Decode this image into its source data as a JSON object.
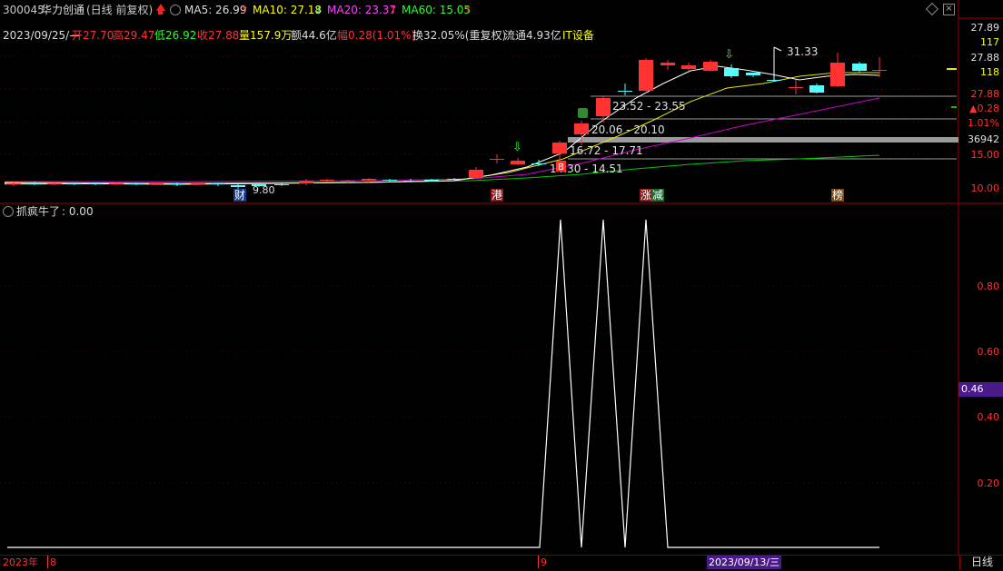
{
  "header": {
    "code": "300045",
    "name": "华力创通",
    "mode": "(日线 前复权)",
    "up_icon": "red-up-arrow-icon",
    "ma5_label": "MA5: 26.99",
    "ma10_label": "MA10: 27.18",
    "ma20_label": "MA20: 23.37",
    "ma60_label": "MA60: 15.05",
    "ma5_arrow": "↑",
    "ma10_arrow": "↓",
    "ma20_arrow": "↑",
    "ma60_arrow": "↑"
  },
  "info": {
    "date": "2023/09/25/—",
    "open": "开27.70",
    "high": "高29.47",
    "low": "低26.92",
    "close": "收27.88",
    "volume": "量157.9万",
    "amount": "额44.6亿",
    "change": "幅0.28(1.01%)",
    "turnover": "换32.05%(重复权)",
    "float": "流通4.93亿",
    "sector": "IT设备"
  },
  "right_axis_top": {
    "v1": "27.89",
    "v2": "117",
    "v3": "27.88",
    "v4": "118",
    "v5": "27.88",
    "v6": "▲0.28",
    "v7": "1.01%",
    "v8": "36942",
    "v9": "15.00",
    "v10": "10.00"
  },
  "chart_annotations": {
    "peak": "31.33",
    "low": "9.80",
    "range1": "23.52 - 23.55",
    "range2": "20.06 - 20.10",
    "range3": "16.72 - 17.71",
    "range4": "14.30 - 14.51"
  },
  "event_tags": {
    "t1": "财",
    "t2": "港",
    "t3": "涨",
    "t4": "减",
    "t5": "榜"
  },
  "indicator": {
    "name": "抓疯牛了",
    "value": ": 0.00",
    "axis": [
      "0.80",
      "0.60",
      "0.40",
      "0.20"
    ],
    "current_badge": "0.46"
  },
  "bottom": {
    "year": "2023年",
    "m8": "8",
    "m9": "9",
    "cursor_date": "2023/09/13/三",
    "period": "日线"
  },
  "colors": {
    "up": "#ff3232",
    "down": "#54ffff",
    "ma5": "#ffffff",
    "ma10": "#ffff00",
    "ma20": "#ff00ff",
    "ma60": "#00ff00"
  },
  "chart_data": {
    "type": "line",
    "title": "抓疯牛了",
    "y_range": [
      0,
      1
    ],
    "series": [
      {
        "name": "抓疯牛了",
        "values": [
          0,
          0,
          0,
          0,
          0,
          0,
          0,
          0,
          0,
          0,
          0,
          0,
          0,
          0,
          0,
          0,
          0,
          0,
          0,
          0,
          0,
          0,
          0,
          0,
          0,
          1,
          0,
          1,
          0,
          1,
          0,
          0,
          0,
          0,
          0,
          0,
          0,
          0,
          0,
          0
        ]
      }
    ]
  }
}
